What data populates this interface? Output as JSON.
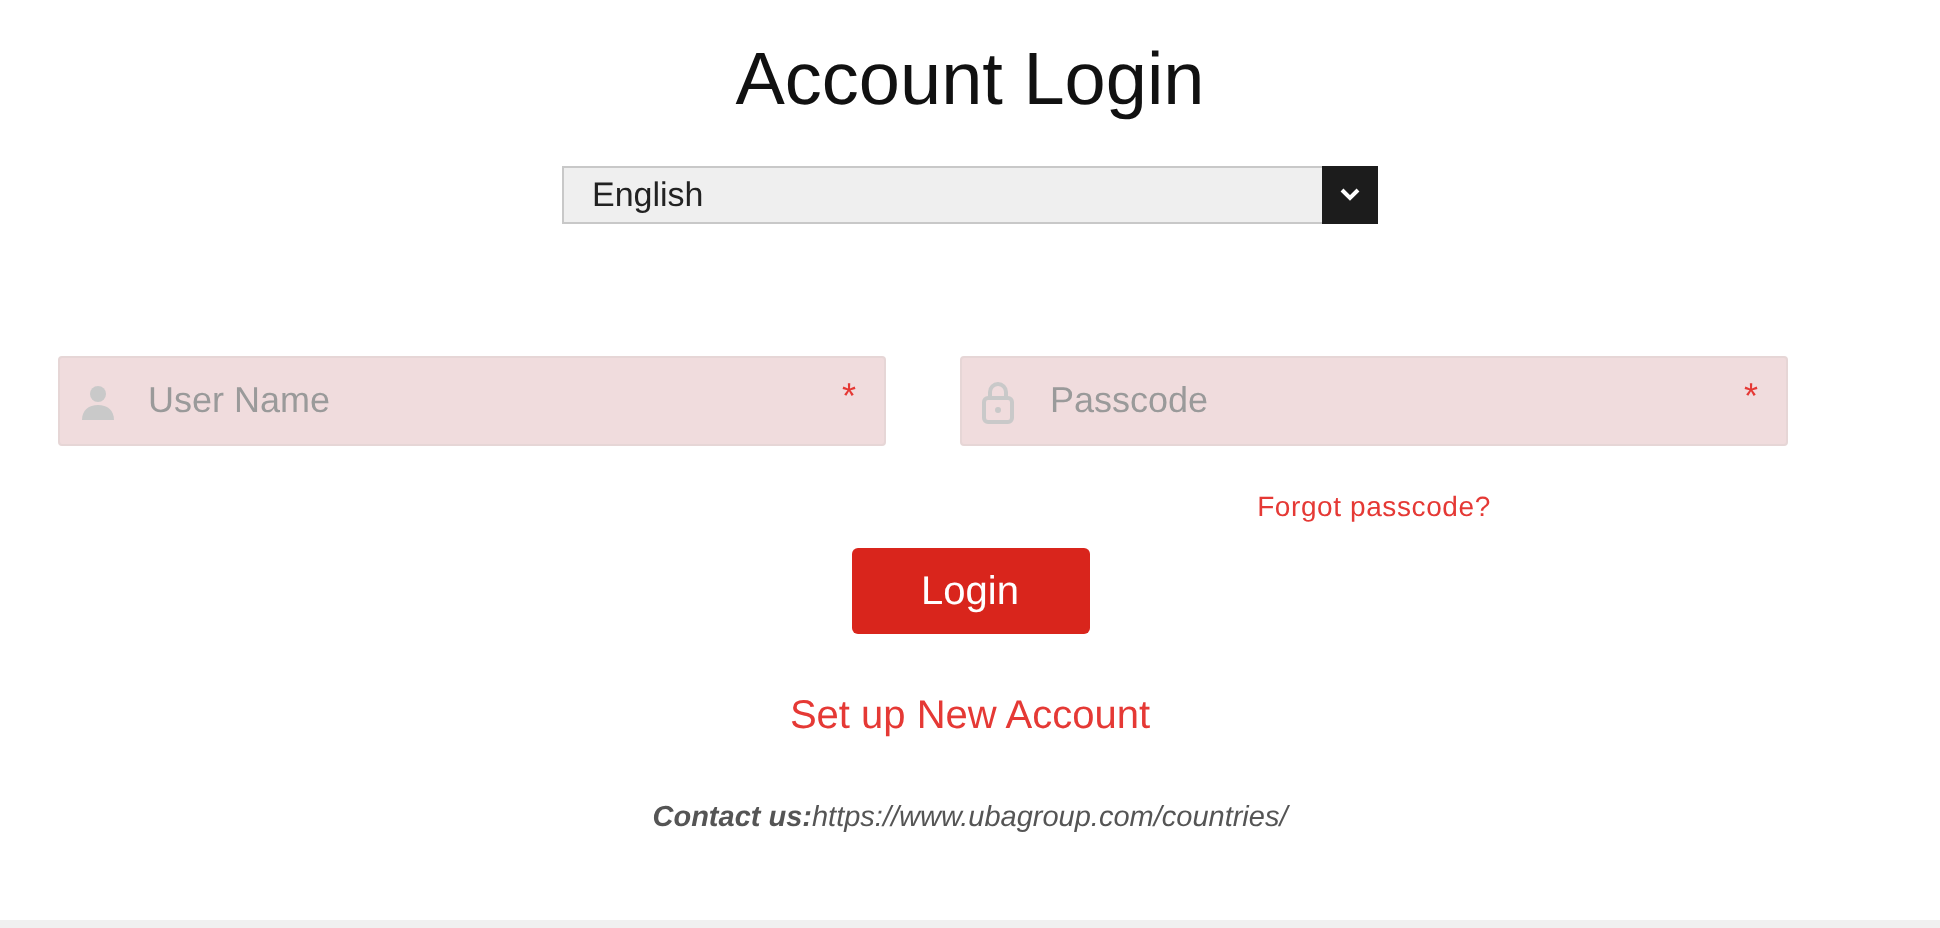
{
  "title": "Account Login",
  "language_select": {
    "value": "English"
  },
  "fields": [
    {
      "kind": "user",
      "placeholder": "User Name",
      "required_mark": "*"
    },
    {
      "kind": "lock",
      "placeholder": "Passcode",
      "required_mark": "*"
    }
  ],
  "forgot_link": "Forgot passcode?",
  "login_button": "Login",
  "setup_link": "Set up New Account",
  "contact": "**Contact us:**https://www.ubagroup.com/countries/"
}
